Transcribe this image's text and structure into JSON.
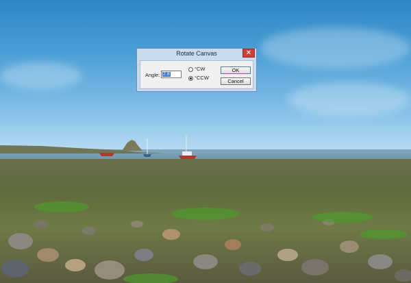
{
  "dialog": {
    "title": "Rotate Canvas",
    "close_glyph": "✕",
    "angle_label": "Angle:",
    "angle_value": "2.8",
    "options": [
      {
        "label": "°CW",
        "selected": false
      },
      {
        "label": "°CCW",
        "selected": true
      }
    ],
    "ok_label": "OK",
    "cancel_label": "Cancel"
  },
  "colors": {
    "titlebar_bg": "#c9dbef",
    "close_button": "#c9403a",
    "selection_highlight": "#3377cc"
  },
  "icons": {
    "close": "close-icon"
  }
}
